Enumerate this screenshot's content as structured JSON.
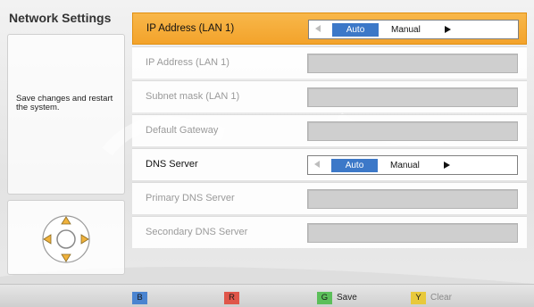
{
  "sidebar": {
    "title": "Network Settings",
    "info_text": "Save changes and restart the system."
  },
  "settings": {
    "rows": [
      {
        "label": "IP Address (LAN 1)",
        "type": "toggle",
        "state": "selected",
        "options": {
          "auto": "Auto",
          "manual": "Manual"
        },
        "selected_option": "Auto"
      },
      {
        "label": "IP Address (LAN 1)",
        "type": "field",
        "state": "disabled",
        "value": ""
      },
      {
        "label": "Subnet mask (LAN 1)",
        "type": "field",
        "state": "disabled",
        "value": ""
      },
      {
        "label": "Default Gateway",
        "type": "field",
        "state": "disabled",
        "value": ""
      },
      {
        "label": "DNS Server",
        "type": "toggle",
        "state": "active",
        "options": {
          "auto": "Auto",
          "manual": "Manual"
        },
        "selected_option": "Auto"
      },
      {
        "label": "Primary DNS Server",
        "type": "field",
        "state": "disabled",
        "value": ""
      },
      {
        "label": "Secondary DNS Server",
        "type": "field",
        "state": "disabled",
        "value": ""
      }
    ]
  },
  "bottom_bar": {
    "keys": [
      {
        "key": "B",
        "color": "#4a84d0",
        "label": ""
      },
      {
        "key": "R",
        "color": "#e0564a",
        "label": ""
      },
      {
        "key": "G",
        "color": "#5cbf5a",
        "label": "Save"
      },
      {
        "key": "Y",
        "color": "#e8c93c",
        "label": "Clear"
      }
    ]
  },
  "colors": {
    "accent_selected": "#f3a32b",
    "toggle_active": "#3c78c8"
  },
  "icons": {
    "remote_dpad": "dpad-icon"
  }
}
